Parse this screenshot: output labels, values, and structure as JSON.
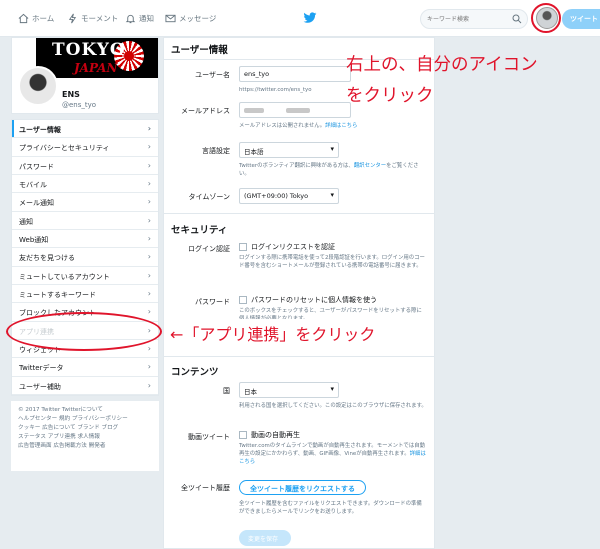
{
  "nav": {
    "home": "ホーム",
    "moments": "モーメント",
    "notifications": "通知",
    "messages": "メッセージ",
    "search_placeholder": "キーワード検索",
    "tweet_button": "ツイート"
  },
  "profile": {
    "banner_top": "TOKYO",
    "banner_bottom": "JAPAN",
    "name": "ENS",
    "handle": "@ens_tyo"
  },
  "menu": [
    {
      "label": "ユーザー情報",
      "active": true
    },
    {
      "label": "プライバシーとセキュリティ"
    },
    {
      "label": "パスワード"
    },
    {
      "label": "モバイル"
    },
    {
      "label": "メール通知"
    },
    {
      "label": "通知"
    },
    {
      "label": "Web通知"
    },
    {
      "label": "友だちを見つける"
    },
    {
      "label": "ミュートしているアカウント"
    },
    {
      "label": "ミュートするキーワード"
    },
    {
      "label": "ブロックしたアカウント"
    },
    {
      "label": "アプリ連携"
    },
    {
      "label": "ウィジェット"
    },
    {
      "label": "Twitterデータ"
    },
    {
      "label": "ユーザー補助"
    }
  ],
  "footer": {
    "line1": "© 2017 Twitter  Twitterについて",
    "line2": "ヘルプセンター  規約  プライバシーポリシー",
    "line3": "クッキー  広告について  ブランド  ブログ",
    "line4": "ステータス  アプリ連携  求人情報",
    "line5": "広告管理画面  広告掲載方法  開発者"
  },
  "main": {
    "user_info_heading": "ユーザー情報",
    "username_label": "ユーザー名",
    "username_value": "ens_tyo",
    "username_url": "https://twitter.com/ens_tyo",
    "email_label": "メールアドレス",
    "email_hint": "メールアドレスは公開されません。",
    "email_hint_link": "詳細はこちら",
    "language_label": "言語設定",
    "language_value": "日本語",
    "language_hint": "Twitterのボランティア翻訳に興味がある方は、",
    "language_hint_link": "翻訳センター",
    "language_hint_tail": "をご覧ください。",
    "timezone_label": "タイムゾーン",
    "timezone_value": "(GMT+09:00) Tokyo",
    "security_heading": "セキュリティ",
    "login_verify_label": "ログイン認証",
    "login_verify_check": "ログインリクエストを認証",
    "login_verify_hint": "ログインする際に携帯電話を使って2段階認証を行います。ログイン用のコード番号を含むショートメールが登録されている携帯の電話番号に届きます。",
    "password_label": "パスワード",
    "password_check": "パスワードのリセットに個人情報を使う",
    "password_hint": "このボックスをチェックすると、ユーザーがパスワードをリセットする際に個人情報が必要となります。",
    "content_heading": "コンテンツ",
    "country_label": "国",
    "country_value": "日本",
    "country_hint": "利用される国を選択してください。この設定はこのブラウザに保存されます。",
    "video_label": "動画ツイート",
    "video_check": "動画の自動再生",
    "video_hint": "Twitter.comのタイムラインで動画が自動再生されます。モーメントでは自動再生の設定にかかわらず、動画、GIF画像、Vineが自動再生されます。",
    "video_hint_link": "詳細はこちら",
    "archive_label": "全ツイート履歴",
    "archive_button": "全ツイート履歴をリクエストする",
    "archive_hint": "全ツイート履歴を含むファイルをリクエストできます。ダウンロードの準備ができましたらメールでリンクをお送りします。",
    "save_button": "変更を保存"
  },
  "annotations": {
    "top_line1": "右上の、自分のアイコン",
    "top_line2": "をクリック",
    "left": "←「アプリ連携」をクリック",
    "color": "#e0142b"
  }
}
